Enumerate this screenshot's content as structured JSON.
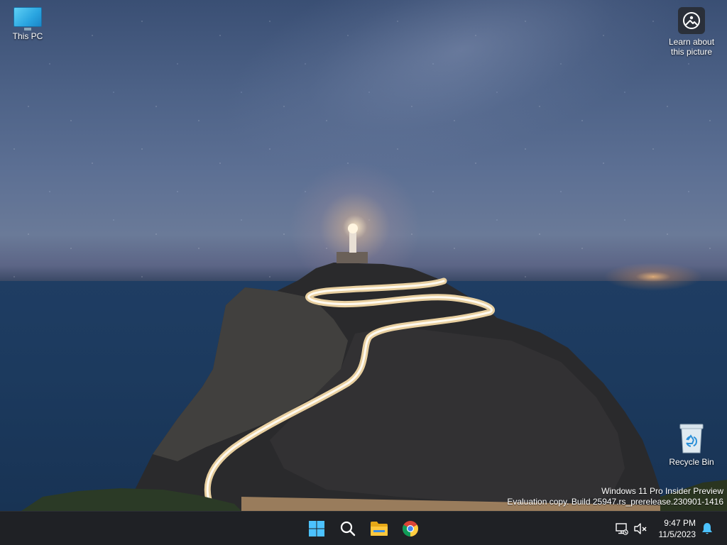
{
  "desktop": {
    "icons": {
      "this_pc": "This PC",
      "learn_line1": "Learn about",
      "learn_line2": "this picture",
      "recycle_bin": "Recycle Bin"
    },
    "watermark": {
      "line1": "Windows 11 Pro Insider Preview",
      "line2": "Evaluation copy. Build 25947.rs_prerelease.230901-1416"
    }
  },
  "taskbar": {
    "apps": [
      "start-icon",
      "search-icon",
      "file-explorer-icon",
      "chrome-icon"
    ],
    "clock": {
      "time": "9:47 PM",
      "date": "11/5/2023"
    },
    "tray": [
      "network-icon",
      "volume-muted-icon",
      "notification-bell-icon"
    ],
    "accent": "#4cc2ff"
  }
}
